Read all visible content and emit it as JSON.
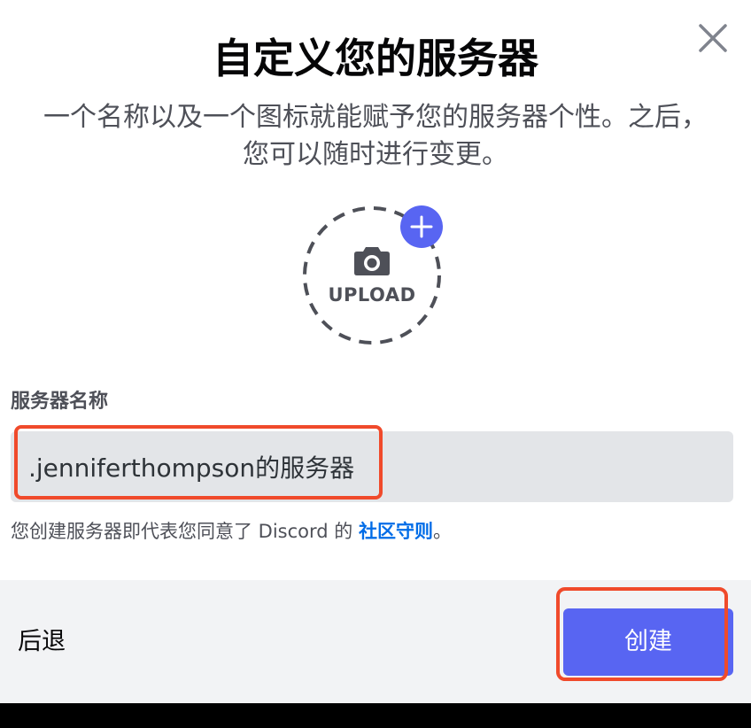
{
  "modal": {
    "title": "自定义您的服务器",
    "subtitle": "一个名称以及一个图标就能赋予您的服务器个性。之后，您可以随时进行变更。",
    "close_icon": "close-icon"
  },
  "upload": {
    "label": "UPLOAD",
    "camera_icon": "camera-icon",
    "plus_icon": "plus-icon"
  },
  "server_name": {
    "label": "服务器名称",
    "value": ".jenniferthompson的服务器"
  },
  "terms": {
    "prefix": "您创建服务器即代表您同意了 Discord 的 ",
    "link": "社区守则",
    "suffix": "。"
  },
  "footer": {
    "back_label": "后退",
    "create_label": "创建"
  },
  "colors": {
    "brand": "#5865f2",
    "highlight": "#f04a2b",
    "link": "#006ce7"
  }
}
